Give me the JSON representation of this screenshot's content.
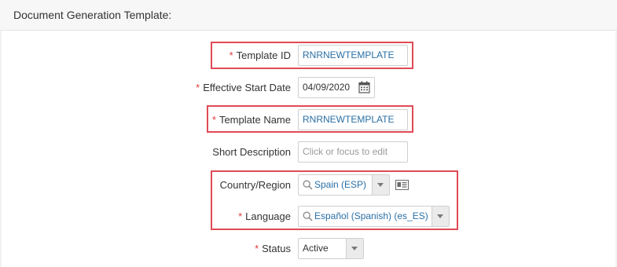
{
  "header": {
    "title": "Document Generation Template:"
  },
  "form": {
    "template_id": {
      "label": "Template ID",
      "value": "RNRNEWTEMPLATE",
      "required": "*"
    },
    "effective_start_date": {
      "label": "Effective Start Date",
      "value": "04/09/2020",
      "required": "*"
    },
    "template_name": {
      "label": "Template Name",
      "value": "RNRNEWTEMPLATE",
      "required": "*"
    },
    "short_description": {
      "label": "Short Description",
      "placeholder": "Click or focus to edit"
    },
    "country_region": {
      "label": "Country/Region",
      "value": "Spain (ESP)"
    },
    "language": {
      "label": "Language",
      "value": "Español (Spanish) (es_ES)",
      "required": "*"
    },
    "status": {
      "label": "Status",
      "value": "Active",
      "required": "*"
    }
  },
  "icons": {
    "calendar": "calendar-icon",
    "search": "search-icon",
    "dropdown": "chevron-down-icon",
    "details": "details-card-icon"
  },
  "colors": {
    "required": "#e23a3a",
    "highlight": "#e04a55",
    "value_text": "#2a6fa5"
  }
}
